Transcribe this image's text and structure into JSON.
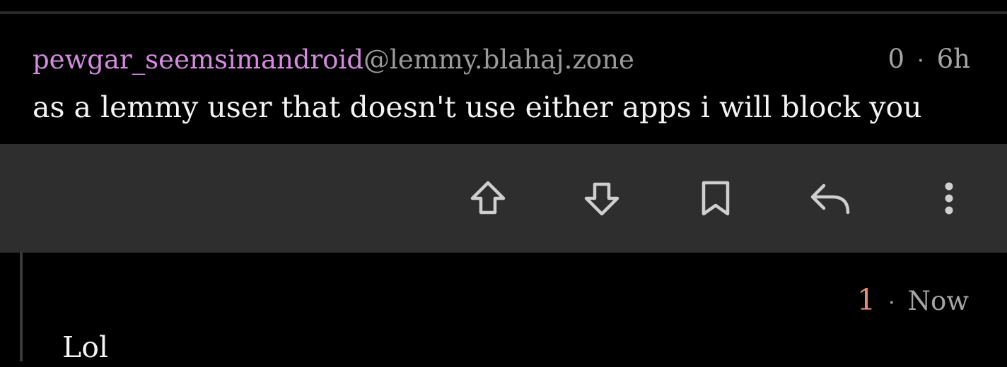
{
  "comment": {
    "username": "pewgar_seemsimandroid",
    "instance": "@lemmy.blahaj.zone",
    "score": "0",
    "separator": "·",
    "age": "6h",
    "body": "as a lemmy user that doesn't use either apps i will block you"
  },
  "actions": [
    {
      "icon": "upvote-icon"
    },
    {
      "icon": "downvote-icon"
    },
    {
      "icon": "bookmark-icon"
    },
    {
      "icon": "reply-icon"
    },
    {
      "icon": "more-vertical-icon"
    }
  ],
  "reply": {
    "score": "1",
    "separator": "·",
    "age": "Now",
    "body": "Lol"
  },
  "colors": {
    "background": "#000000",
    "action_bar": "#2e2e2e",
    "username": "#d48be0",
    "instance": "#9a9a9a",
    "meta": "#a5a5a5",
    "text": "#f4f4f4",
    "upvoted_score": "#e58b7d",
    "icon": "#cfcfcf"
  }
}
